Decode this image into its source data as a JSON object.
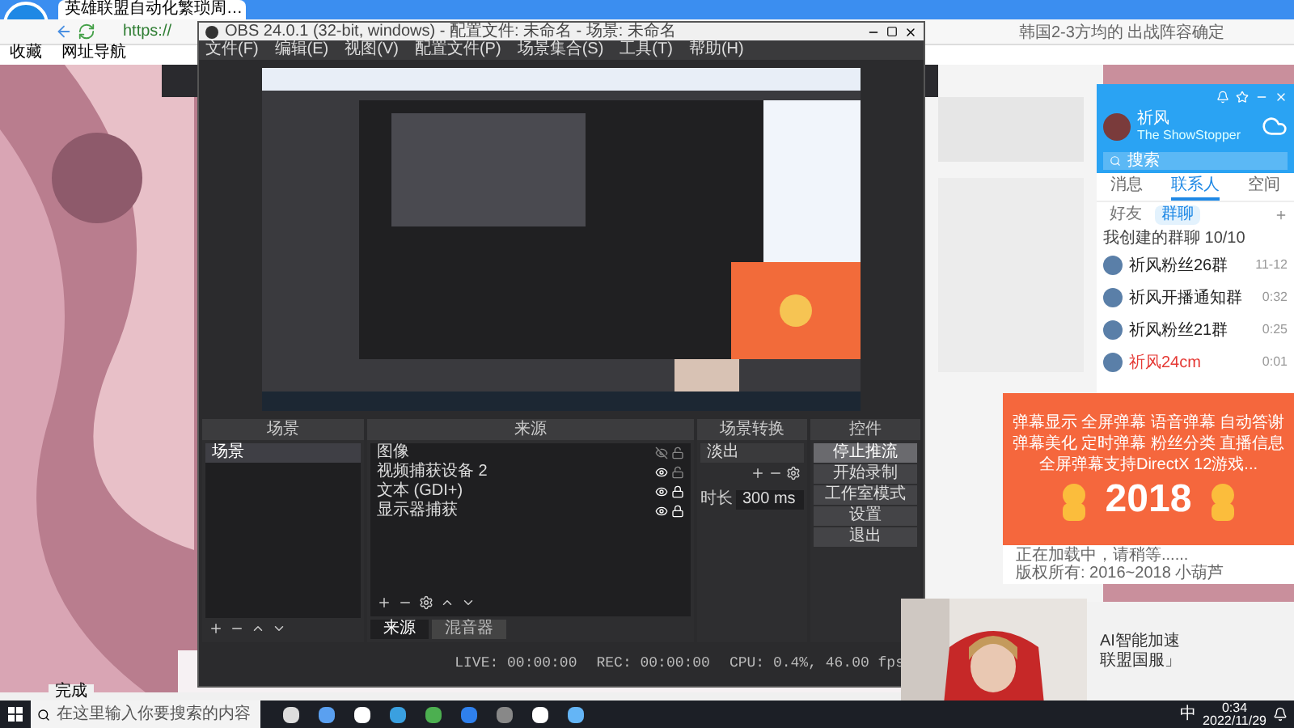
{
  "browser": {
    "tab_title": "英雄联盟自动化繁琐周…",
    "address": "https://",
    "bookmarks": [
      "收藏",
      "网址导航"
    ],
    "search_hint": "韩国2-3方均的 出战阵容确定",
    "status": "完成"
  },
  "obs": {
    "title": "OBS 24.0.1 (32-bit, windows) - 配置文件: 未命名 - 场景: 未命名",
    "menu": [
      "文件(F)",
      "编辑(E)",
      "视图(V)",
      "配置文件(P)",
      "场景集合(S)",
      "工具(T)",
      "帮助(H)"
    ],
    "scenes": {
      "title": "场景",
      "items": [
        {
          "label": "场景",
          "selected": true
        }
      ]
    },
    "sources": {
      "title": "来源",
      "items": [
        {
          "label": "图像",
          "visible": false,
          "locked": false
        },
        {
          "label": "视频捕获设备 2",
          "visible": true,
          "locked": false
        },
        {
          "label": "文本 (GDI+)",
          "visible": true,
          "locked": true
        },
        {
          "label": "显示器捕获",
          "visible": true,
          "locked": true
        }
      ],
      "tabs": [
        {
          "label": "来源",
          "selected": true
        },
        {
          "label": "混音器",
          "selected": false
        }
      ]
    },
    "transitions": {
      "title": "场景转换",
      "value": "淡出",
      "duration_label": "时长",
      "duration": "300 ms"
    },
    "controls": {
      "title": "控件",
      "buttons": [
        {
          "label": "停止推流",
          "active": true
        },
        {
          "label": "开始录制",
          "active": false
        },
        {
          "label": "工作室模式",
          "active": false
        },
        {
          "label": "设置",
          "active": false
        },
        {
          "label": "退出",
          "active": false
        }
      ]
    },
    "status": [
      "LIVE: 00:00:00",
      "REC: 00:00:00",
      "CPU: 0.4%, 46.00 fps"
    ]
  },
  "qq": {
    "name": "祈风",
    "signature": "The ShowStopper",
    "search": "搜索",
    "tabs": [
      {
        "label": "消息",
        "selected": false
      },
      {
        "label": "联系人",
        "selected": true
      },
      {
        "label": "空间",
        "selected": false
      }
    ],
    "subtabs": [
      {
        "label": "好友",
        "selected": false
      },
      {
        "label": "群聊",
        "selected": true
      }
    ],
    "group": "我创建的群聊 10/10",
    "chats": [
      {
        "name": "祈风粉丝26群",
        "time": "11-12",
        "color": "#222222"
      },
      {
        "name": "祈风开播通知群",
        "time": "0:32",
        "color": "#222222"
      },
      {
        "name": "祈风粉丝21群",
        "time": "0:25",
        "color": "#222222"
      },
      {
        "name": "祈风24cm",
        "time": "0:01",
        "color": "#e53935"
      }
    ]
  },
  "ad": {
    "features": [
      "弹幕显示 全屏弹幕 语音弹幕 自动答谢",
      "弹幕美化 定时弹幕 粉丝分类 直播信息"
    ],
    "headline": "全屏弹幕支持DirectX 12游戏...",
    "year": "2018",
    "loading": "正在加载中，请稍等......",
    "copyright": "版权所有:  2016~2018 小葫芦"
  },
  "overlay": {
    "lines": [
      "AI智能加速",
      "联盟国服」"
    ]
  },
  "taskbar": {
    "search": "在这里输入你要搜索的内容",
    "ime": "中",
    "time": "0:34",
    "date": "2022/11/29"
  }
}
